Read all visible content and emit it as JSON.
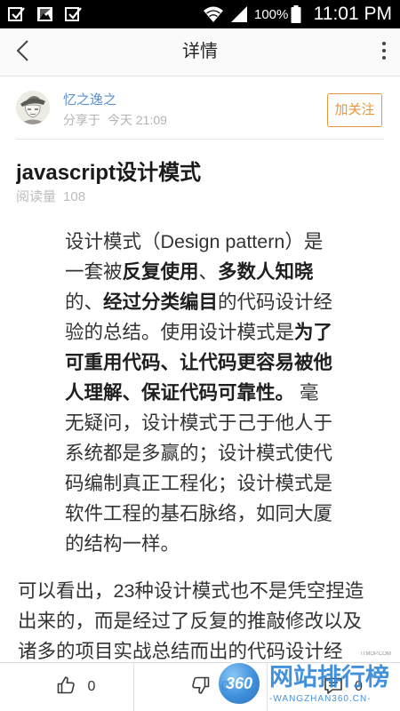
{
  "status_bar": {
    "notification_icons": [
      "checkbox-icon",
      "image-icon",
      "checkbox-icon"
    ],
    "system_icons": [
      "wifi-icon",
      "signal-icon",
      "battery-icon"
    ],
    "battery_percent": "100%",
    "time": "11:01 PM"
  },
  "header": {
    "title": "详情",
    "back_icon": "chevron-left-icon",
    "menu_icon": "more-vertical-icon"
  },
  "author": {
    "name": "忆之逸之",
    "share_label": "分享于",
    "share_time": "今天 21:09",
    "follow_label": "加关注"
  },
  "article": {
    "title": "javascript设计模式",
    "read_label": "阅读量",
    "read_count": "108",
    "quote_segments": [
      {
        "text": "设计模式（Design pattern）是一套被",
        "bold": false
      },
      {
        "text": "反复使用",
        "bold": true
      },
      {
        "text": "、",
        "bold": false
      },
      {
        "text": "多数人知晓",
        "bold": true
      },
      {
        "text": "的、",
        "bold": false
      },
      {
        "text": "经过分类编目",
        "bold": true
      },
      {
        "text": "的代码设计经验的总结。使用设计模式是",
        "bold": false
      },
      {
        "text": "为了可重用代码、让代码更容易被他人理解、保证代码可靠性。",
        "bold": true
      },
      {
        "text": " 毫无疑问，设计模式于己于他人于系统都是多赢的；设计模式使代码编制真正工程化；设计模式是软件工程的基石脉络，如同大厦的结构一样。",
        "bold": false
      }
    ],
    "paragraph": "可以看出，23种设计模式也不是凭空捏造出来的，而是经过了反复的推敲修改以及诸多的项目实战总结而出的代码设计经"
  },
  "bottom_bar": {
    "like": {
      "icon": "thumbs-up-icon",
      "count": "0"
    },
    "dislike": {
      "icon": "thumbs-down-icon",
      "count": "0"
    },
    "comment": {
      "icon": "comment-icon",
      "count": "0"
    }
  },
  "watermark": {
    "site": "ITMOP.COM",
    "logo_text": "360",
    "title": "网站排行榜",
    "subtitle": "-WANGZHAN360.CN-"
  },
  "colors": {
    "accent_orange": "#e8963a",
    "author_blue": "#5b8fcf",
    "watermark_blue": "#2f86d8",
    "status_bar_bg": "#000000"
  }
}
